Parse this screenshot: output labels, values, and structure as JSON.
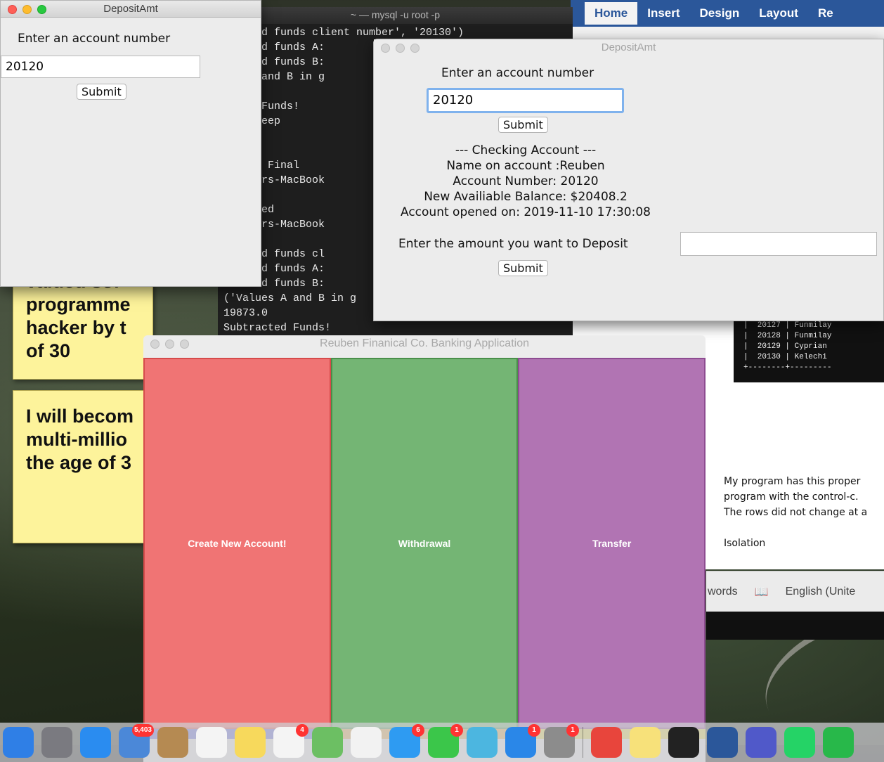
{
  "terminal": {
    "title": "~ — mysql -u root -p",
    "lines": [
      "tracted funds client number', '20130')",
      "tracted funds A:",
      "tracted funds B:",
      "ues A and B in g",
      ".0",
      "acted Funds!",
      " to sleep",
      " up!",
      ".2",
      " Funds Final",
      ") Owners-MacBook",
      "",
      " Stopped",
      ") Owners-MacBook",
      ".0",
      "tracted funds cl",
      "tracted funds A:",
      "tracted funds B:",
      "('Values A and B in g",
      "19873.0",
      "Subtracted Funds!"
    ]
  },
  "word": {
    "tabs": [
      "Home",
      "Insert",
      "Design",
      "Layout",
      "Re"
    ],
    "table_rows": [
      "|  20127 | Funmilay",
      "|  20128 | Funmilay",
      "|  20129 | Cyprian",
      "|  20130 | Kelechi",
      "+--------+---------"
    ],
    "doc_lines": [
      "My program has this proper",
      "program with the control-c.",
      "The rows did not change at a",
      "",
      "Isolation"
    ],
    "status": {
      "words": "words",
      "language": "English (Unite"
    }
  },
  "stickies": {
    "note1": [
      "valued sof",
      "programme",
      "hacker by t",
      "of 30"
    ],
    "note2": [
      "I will becom",
      "multi-millio",
      "the age of 3"
    ]
  },
  "deposit_small": {
    "title": "DepositAmt",
    "prompt": "Enter an account number",
    "account_value": "20120",
    "submit_label": "Submit"
  },
  "deposit_large": {
    "title": "DepositAmt",
    "prompt": "Enter an account number",
    "account_value": "20120",
    "submit_label": "Submit",
    "info": {
      "heading": "--- Checking Account ---",
      "name": "Name on account :Reuben",
      "number": "Account Number: 20120",
      "balance": "New Availiable Balance: $20408.2",
      "opened": "Account opened on: 2019-11-10 17:30:08"
    },
    "deposit_label": "Enter the amount you want to Deposit",
    "deposit_value": "",
    "submit2_label": "Submit"
  },
  "bank_app": {
    "title": "Reuben Finanical Co. Banking Application",
    "buttons": {
      "create": "Create New Account!",
      "withdraw": "Withdrawal",
      "transfer": "Transfer"
    },
    "colors": {
      "create": "#f07474",
      "withdraw": "#74b574",
      "transfer": "#b174b3"
    }
  },
  "dock": {
    "icons": [
      {
        "name": "finder-icon",
        "color": "#2f7fe6",
        "badge": ""
      },
      {
        "name": "launchpad-icon",
        "color": "#7a7a80",
        "badge": ""
      },
      {
        "name": "safari-icon",
        "color": "#2a8cf0",
        "badge": ""
      },
      {
        "name": "mail-icon",
        "color": "#4b88d8",
        "badge": "5,403"
      },
      {
        "name": "contacts-icon",
        "color": "#b58a52",
        "badge": ""
      },
      {
        "name": "calendar-icon",
        "color": "#f4f4f4",
        "badge": ""
      },
      {
        "name": "notes-icon",
        "color": "#f7d95c",
        "badge": ""
      },
      {
        "name": "reminders-icon",
        "color": "#f4f4f4",
        "badge": "4"
      },
      {
        "name": "maps-icon",
        "color": "#6cbf63",
        "badge": ""
      },
      {
        "name": "photos-icon",
        "color": "#f2f2f2",
        "badge": ""
      },
      {
        "name": "messages-icon",
        "color": "#2e9bf2",
        "badge": "6"
      },
      {
        "name": "facetime-icon",
        "color": "#3bc64a",
        "badge": "1"
      },
      {
        "name": "itunes-icon",
        "color": "#4cb6e0",
        "badge": ""
      },
      {
        "name": "app-store-icon",
        "color": "#2a87e8",
        "badge": "1"
      },
      {
        "name": "system-preferences-icon",
        "color": "#8c8c8c",
        "badge": "1"
      },
      {
        "name": "chrome-icon",
        "color": "#e8453c",
        "badge": ""
      },
      {
        "name": "stickies-icon",
        "color": "#f7e17a",
        "badge": ""
      },
      {
        "name": "terminal-icon",
        "color": "#222222",
        "badge": ""
      },
      {
        "name": "word-icon",
        "color": "#2b579a",
        "badge": ""
      },
      {
        "name": "teams-icon",
        "color": "#5059c9",
        "badge": ""
      },
      {
        "name": "whatsapp-icon",
        "color": "#25d366",
        "badge": ""
      },
      {
        "name": "app-icon",
        "color": "#28b84a",
        "badge": ""
      }
    ]
  }
}
